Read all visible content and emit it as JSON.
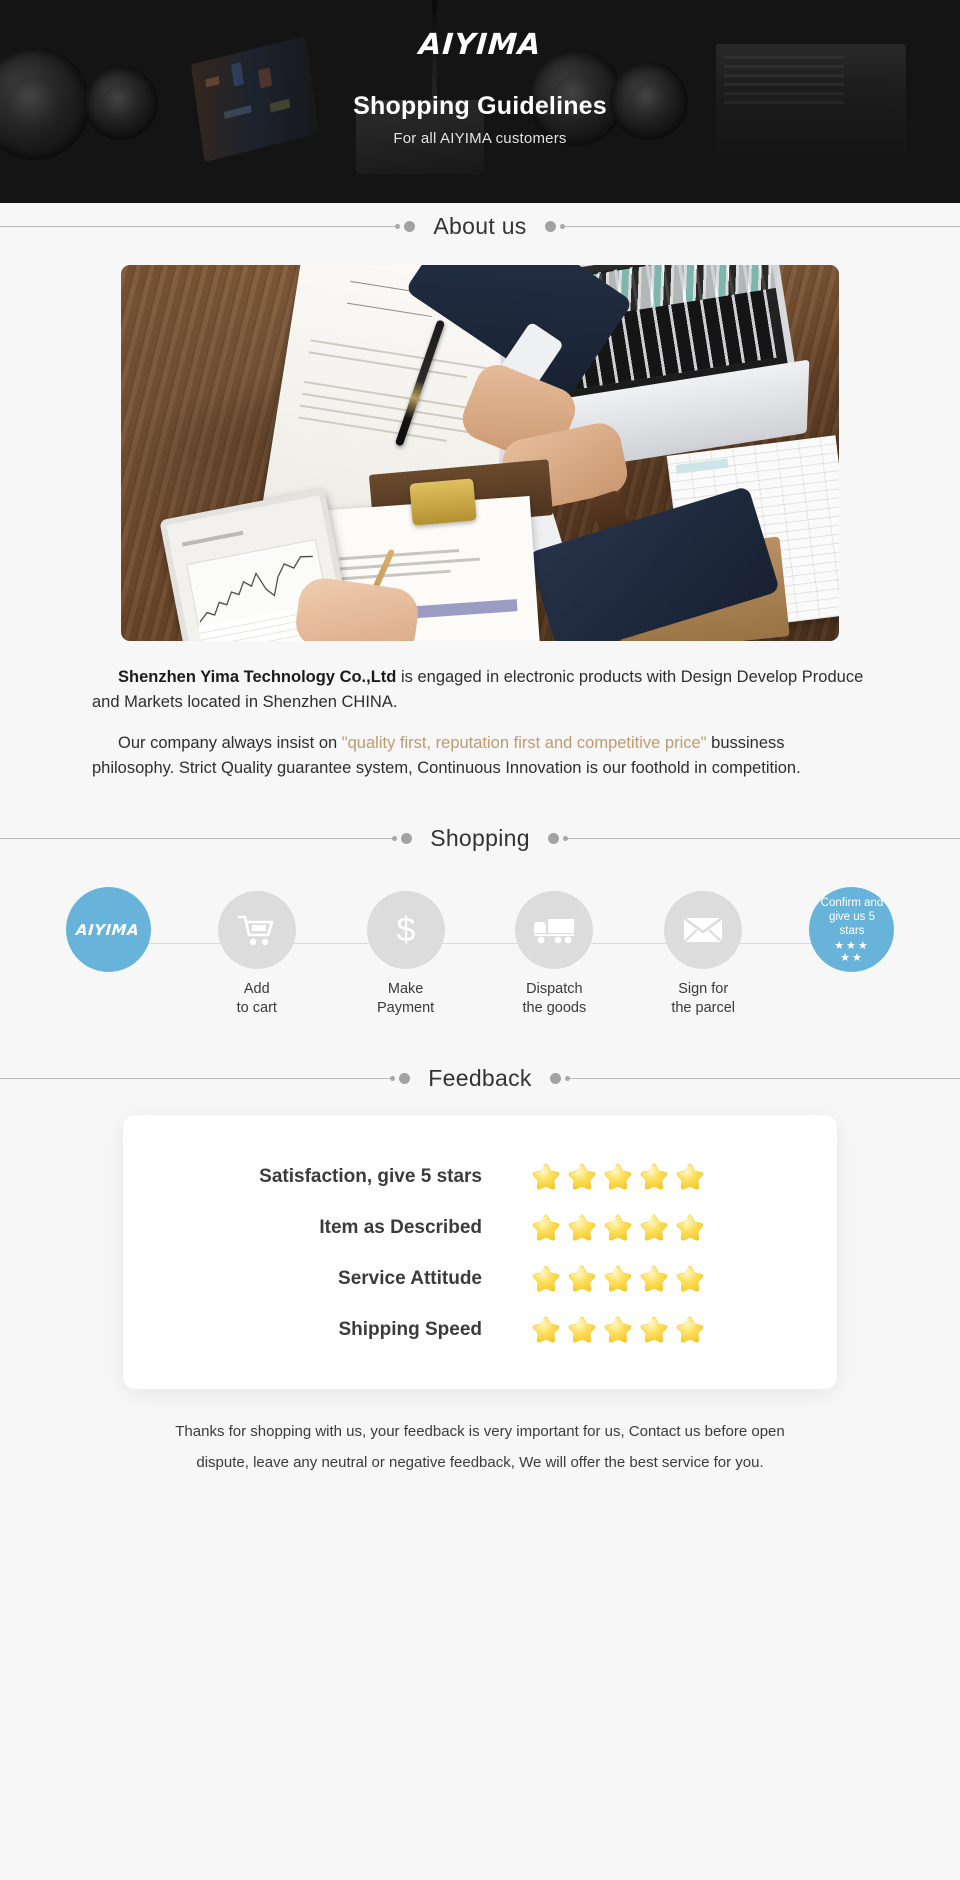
{
  "hero": {
    "logo": "AIYIMA",
    "title": "Shopping Guidelines",
    "subtitle": "For all AIYIMA customers"
  },
  "sections": {
    "about_title": "About us",
    "shopping_title": "Shopping",
    "feedback_title": "Feedback"
  },
  "about": {
    "paragraph1_company": "Shenzhen Yima Technology Co.,Ltd",
    "paragraph1_rest": " is engaged in electronic products with Design Develop Produce and Markets located in Shenzhen CHINA.",
    "paragraph2_pre": "Our company always insist on ",
    "paragraph2_quote": "\"quality first, reputation first and competitive price\"",
    "paragraph2_post": " bussiness philosophy. Strict Quality guarantee system, Continuous Innovation is our foothold in competition."
  },
  "steps": [
    {
      "id": "brand",
      "icon": "aiyima-logo-icon",
      "label": "",
      "label2": "",
      "brand": "AIYIMA",
      "accent": "#68b3da"
    },
    {
      "id": "add-to-cart",
      "icon": "shopping-cart-icon",
      "label": "Add",
      "label2": "to cart"
    },
    {
      "id": "make-payment",
      "icon": "dollar-sign-icon",
      "label": "Make",
      "label2": "Payment"
    },
    {
      "id": "dispatch-goods",
      "icon": "delivery-truck-icon",
      "label": "Dispatch",
      "label2": "the goods"
    },
    {
      "id": "sign-parcel",
      "icon": "envelope-icon",
      "label": "Sign for",
      "label2": "the parcel"
    },
    {
      "id": "confirm-rate",
      "icon": "five-stars-icon",
      "label": "",
      "label2": "",
      "line1": "Confirm and",
      "line2": "give us 5 stars",
      "stars_row1": "★★★",
      "stars_row2": "★★",
      "accent": "#68b3da"
    }
  ],
  "feedback": {
    "rows": [
      {
        "label": "Satisfaction, give 5 stars",
        "stars": 5
      },
      {
        "label": "Item as Described",
        "stars": 5
      },
      {
        "label": "Service Attitude",
        "stars": 5
      },
      {
        "label": "Shipping Speed",
        "stars": 5
      }
    ]
  },
  "footer": {
    "line1": "Thanks for shopping with us, your feedback is very important for us, Contact us before open",
    "line2": "dispute, leave any neutral or negative feedback, We will offer the best service for you."
  },
  "colors": {
    "accent_blue": "#68b3da",
    "quote_tan": "#bf9b6e",
    "page_bg": "#f7f7f7",
    "hero_bg": "#1a1a1a",
    "star_yellow": "#fcd94b"
  }
}
